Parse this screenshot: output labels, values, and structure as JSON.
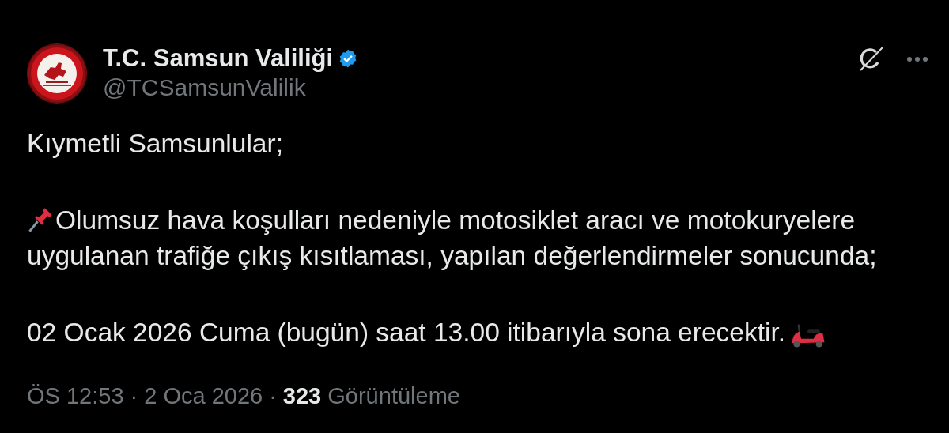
{
  "author": {
    "name": "T.C. Samsun Valiliği",
    "verified": true,
    "handle": "@TCSamsunValilik"
  },
  "body": [
    {
      "kind": "text",
      "text": "Kıymetli Samsunlular;"
    },
    {
      "kind": "pin",
      "text": "Olumsuz hava koşulları nedeniyle motosiklet aracı ve motokuryelere",
      "continuation": "uygulanan trafiğe çıkış kısıtlaması, yapılan değerlendirmeler sonucunda;"
    },
    {
      "kind": "scooter",
      "text": "02 Ocak 2026 Cuma (bugün) saat 13.00 itibarıyla sona erecektir."
    }
  ],
  "meta": {
    "time": "ÖS 12:53",
    "separator_1": "·",
    "date": "2 Oca 2026",
    "separator_2": "·",
    "views": "**323** Görüntüleme"
  }
}
